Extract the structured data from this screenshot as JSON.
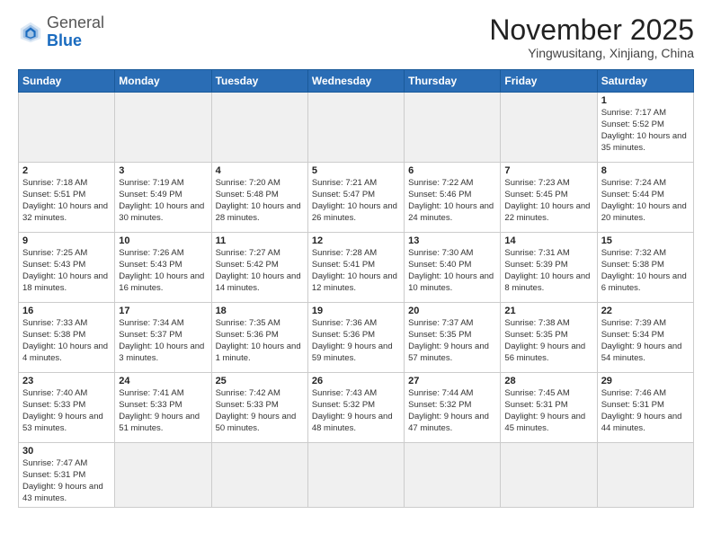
{
  "header": {
    "logo_general": "General",
    "logo_blue": "Blue",
    "month_year": "November 2025",
    "location": "Yingwusitang, Xinjiang, China"
  },
  "weekdays": [
    "Sunday",
    "Monday",
    "Tuesday",
    "Wednesday",
    "Thursday",
    "Friday",
    "Saturday"
  ],
  "days": [
    {
      "num": "",
      "info": ""
    },
    {
      "num": "",
      "info": ""
    },
    {
      "num": "",
      "info": ""
    },
    {
      "num": "",
      "info": ""
    },
    {
      "num": "",
      "info": ""
    },
    {
      "num": "",
      "info": ""
    },
    {
      "num": "1",
      "info": "Sunrise: 7:17 AM\nSunset: 5:52 PM\nDaylight: 10 hours and 35 minutes."
    },
    {
      "num": "2",
      "info": "Sunrise: 7:18 AM\nSunset: 5:51 PM\nDaylight: 10 hours and 32 minutes."
    },
    {
      "num": "3",
      "info": "Sunrise: 7:19 AM\nSunset: 5:49 PM\nDaylight: 10 hours and 30 minutes."
    },
    {
      "num": "4",
      "info": "Sunrise: 7:20 AM\nSunset: 5:48 PM\nDaylight: 10 hours and 28 minutes."
    },
    {
      "num": "5",
      "info": "Sunrise: 7:21 AM\nSunset: 5:47 PM\nDaylight: 10 hours and 26 minutes."
    },
    {
      "num": "6",
      "info": "Sunrise: 7:22 AM\nSunset: 5:46 PM\nDaylight: 10 hours and 24 minutes."
    },
    {
      "num": "7",
      "info": "Sunrise: 7:23 AM\nSunset: 5:45 PM\nDaylight: 10 hours and 22 minutes."
    },
    {
      "num": "8",
      "info": "Sunrise: 7:24 AM\nSunset: 5:44 PM\nDaylight: 10 hours and 20 minutes."
    },
    {
      "num": "9",
      "info": "Sunrise: 7:25 AM\nSunset: 5:43 PM\nDaylight: 10 hours and 18 minutes."
    },
    {
      "num": "10",
      "info": "Sunrise: 7:26 AM\nSunset: 5:43 PM\nDaylight: 10 hours and 16 minutes."
    },
    {
      "num": "11",
      "info": "Sunrise: 7:27 AM\nSunset: 5:42 PM\nDaylight: 10 hours and 14 minutes."
    },
    {
      "num": "12",
      "info": "Sunrise: 7:28 AM\nSunset: 5:41 PM\nDaylight: 10 hours and 12 minutes."
    },
    {
      "num": "13",
      "info": "Sunrise: 7:30 AM\nSunset: 5:40 PM\nDaylight: 10 hours and 10 minutes."
    },
    {
      "num": "14",
      "info": "Sunrise: 7:31 AM\nSunset: 5:39 PM\nDaylight: 10 hours and 8 minutes."
    },
    {
      "num": "15",
      "info": "Sunrise: 7:32 AM\nSunset: 5:38 PM\nDaylight: 10 hours and 6 minutes."
    },
    {
      "num": "16",
      "info": "Sunrise: 7:33 AM\nSunset: 5:38 PM\nDaylight: 10 hours and 4 minutes."
    },
    {
      "num": "17",
      "info": "Sunrise: 7:34 AM\nSunset: 5:37 PM\nDaylight: 10 hours and 3 minutes."
    },
    {
      "num": "18",
      "info": "Sunrise: 7:35 AM\nSunset: 5:36 PM\nDaylight: 10 hours and 1 minute."
    },
    {
      "num": "19",
      "info": "Sunrise: 7:36 AM\nSunset: 5:36 PM\nDaylight: 9 hours and 59 minutes."
    },
    {
      "num": "20",
      "info": "Sunrise: 7:37 AM\nSunset: 5:35 PM\nDaylight: 9 hours and 57 minutes."
    },
    {
      "num": "21",
      "info": "Sunrise: 7:38 AM\nSunset: 5:35 PM\nDaylight: 9 hours and 56 minutes."
    },
    {
      "num": "22",
      "info": "Sunrise: 7:39 AM\nSunset: 5:34 PM\nDaylight: 9 hours and 54 minutes."
    },
    {
      "num": "23",
      "info": "Sunrise: 7:40 AM\nSunset: 5:33 PM\nDaylight: 9 hours and 53 minutes."
    },
    {
      "num": "24",
      "info": "Sunrise: 7:41 AM\nSunset: 5:33 PM\nDaylight: 9 hours and 51 minutes."
    },
    {
      "num": "25",
      "info": "Sunrise: 7:42 AM\nSunset: 5:33 PM\nDaylight: 9 hours and 50 minutes."
    },
    {
      "num": "26",
      "info": "Sunrise: 7:43 AM\nSunset: 5:32 PM\nDaylight: 9 hours and 48 minutes."
    },
    {
      "num": "27",
      "info": "Sunrise: 7:44 AM\nSunset: 5:32 PM\nDaylight: 9 hours and 47 minutes."
    },
    {
      "num": "28",
      "info": "Sunrise: 7:45 AM\nSunset: 5:31 PM\nDaylight: 9 hours and 45 minutes."
    },
    {
      "num": "29",
      "info": "Sunrise: 7:46 AM\nSunset: 5:31 PM\nDaylight: 9 hours and 44 minutes."
    },
    {
      "num": "30",
      "info": "Sunrise: 7:47 AM\nSunset: 5:31 PM\nDaylight: 9 hours and 43 minutes."
    },
    {
      "num": "",
      "info": ""
    },
    {
      "num": "",
      "info": ""
    },
    {
      "num": "",
      "info": ""
    },
    {
      "num": "",
      "info": ""
    },
    {
      "num": "",
      "info": ""
    },
    {
      "num": "",
      "info": ""
    }
  ]
}
